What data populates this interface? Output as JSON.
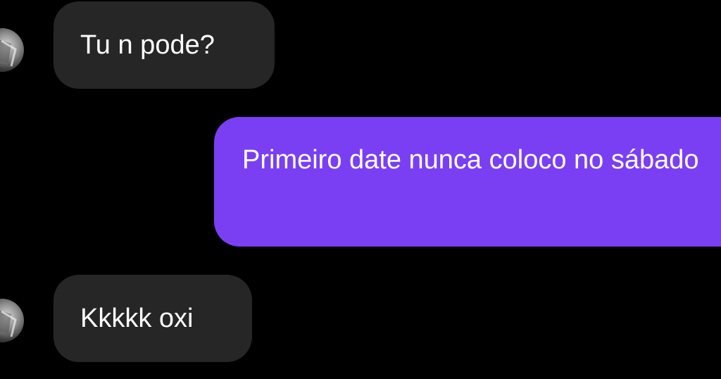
{
  "conversation": {
    "messages": [
      {
        "sender": "contact",
        "text": "Tu n pode?"
      },
      {
        "sender": "me",
        "text": "Primeiro date nunca coloco no sábado"
      },
      {
        "sender": "contact",
        "text": "Kkkkk oxi"
      }
    ]
  },
  "colors": {
    "background": "#000000",
    "incoming_bubble": "#262626",
    "outgoing_bubble": "#7a3ff2",
    "text": "#ffffff"
  },
  "icons": {
    "avatar": "contact-avatar-icon"
  }
}
